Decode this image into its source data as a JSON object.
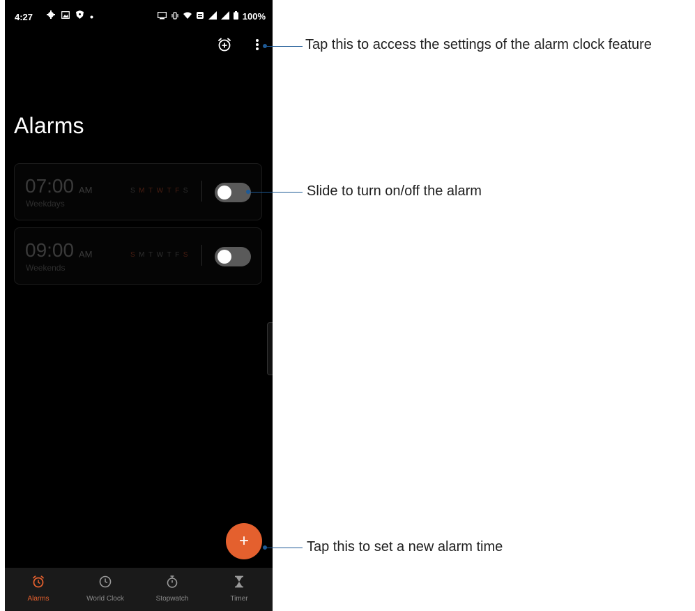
{
  "status_bar": {
    "time": "4:27",
    "battery": "100%"
  },
  "page": {
    "title": "Alarms"
  },
  "alarms": [
    {
      "time": "07:00",
      "ampm": "AM",
      "label": "Weekdays",
      "days": [
        "S",
        "M",
        "T",
        "W",
        "T",
        "F",
        "S"
      ],
      "active_days": [
        false,
        true,
        true,
        true,
        true,
        true,
        false
      ],
      "enabled": false
    },
    {
      "time": "09:00",
      "ampm": "AM",
      "label": "Weekends",
      "days": [
        "S",
        "M",
        "T",
        "W",
        "T",
        "F",
        "S"
      ],
      "active_days": [
        true,
        false,
        false,
        false,
        false,
        false,
        true
      ],
      "enabled": false
    }
  ],
  "fab": {
    "symbol": "+"
  },
  "nav": [
    {
      "label": "Alarms",
      "icon": "alarm-clock-icon",
      "active": true
    },
    {
      "label": "World Clock",
      "icon": "clock-icon",
      "active": false
    },
    {
      "label": "Stopwatch",
      "icon": "stopwatch-icon",
      "active": false
    },
    {
      "label": "Timer",
      "icon": "hourglass-icon",
      "active": false
    }
  ],
  "callouts": {
    "settings": "Tap this to access the settings of the alarm clock feature",
    "toggle": "Slide to turn on/off the alarm",
    "add": "Tap this to set a new alarm time"
  },
  "colors": {
    "accent": "#e4602e",
    "callout_line": "#1e5a96",
    "background": "#000000"
  }
}
